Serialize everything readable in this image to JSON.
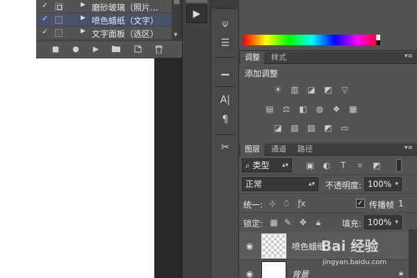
{
  "actions": {
    "rows": [
      {
        "checked": "✓",
        "label": "磨砂玻璃（照片...",
        "selected": false
      },
      {
        "checked": "✓",
        "label": "喷色蜡纸（文字）",
        "selected": true
      },
      {
        "checked": "✓",
        "label": "文字面板（选区）",
        "selected": false
      }
    ],
    "toolbar": {
      "stop": "■",
      "record": "●",
      "play": "▶",
      "new_set": "folder-icon",
      "new_action": "new-icon",
      "delete": "trash-icon"
    }
  },
  "play_button": {
    "label": "▶"
  },
  "tools": [
    {
      "icon": "brush-settings-icon",
      "glyph": "⍦"
    },
    {
      "icon": "paragraph-style-icon",
      "glyph": "☰"
    },
    {
      "icon": "clone-source-icon",
      "glyph": "▁"
    },
    {
      "icon": "character-icon",
      "glyph": "A|"
    },
    {
      "icon": "paragraph-icon",
      "glyph": "¶"
    },
    {
      "icon": "tool-presets-icon",
      "glyph": "✂"
    }
  ],
  "adjustments": {
    "tabs": [
      "调整",
      "样式"
    ],
    "title": "添加调整",
    "rows": [
      [
        "☀",
        "▥",
        "◪",
        "◩",
        "▽"
      ],
      [
        "▤",
        "⚖",
        "◧",
        "◍",
        "❖",
        "▦"
      ],
      [
        "◪",
        "▨",
        "▧",
        "◩",
        "▭"
      ]
    ]
  },
  "layers": {
    "tabs": [
      "图层",
      "通道",
      "路径"
    ],
    "filter_label": "类型",
    "filter_icons": [
      "▣",
      "◐",
      "T",
      "⌗",
      "◩"
    ],
    "blend_mode": "正常",
    "opacity_label": "不透明度:",
    "opacity_value": "100%",
    "unify_label": "统一:",
    "propagate_label": "传播帧",
    "propagate_value": "1",
    "lock_label": "锁定:",
    "fill_label": "填充:",
    "fill_value": "100%",
    "items": [
      {
        "name": "喷色蜡纸",
        "visible": "👁",
        "selected": true
      },
      {
        "name": "背景",
        "visible": "👁",
        "selected": false
      }
    ]
  },
  "watermark": {
    "brand": "Bai 经验",
    "url": "jingyan.baidu.com"
  }
}
